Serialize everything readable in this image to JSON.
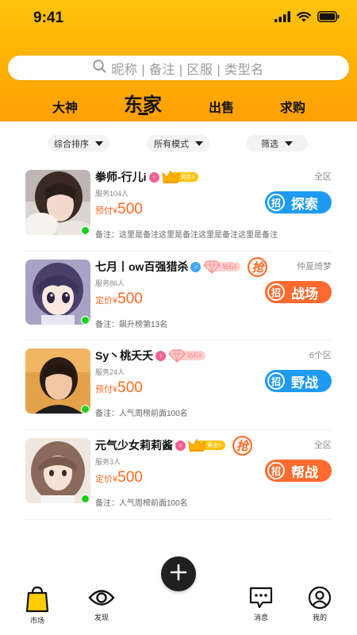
{
  "status_bar": {
    "time": "9:41"
  },
  "search": {
    "placeholder": "昵称 | 备注 | 区服 | 类型名"
  },
  "top_tabs": [
    {
      "label": "大神",
      "active": false
    },
    {
      "label": "东家",
      "active": true
    },
    {
      "label": "出售",
      "active": false
    },
    {
      "label": "求购",
      "active": false
    }
  ],
  "filters": [
    {
      "label": "综合排序"
    },
    {
      "label": "所有模式"
    },
    {
      "label": "筛选"
    }
  ],
  "listings": [
    {
      "name": "拳师-行儿i",
      "gender": "female",
      "gender_glyph": "♀",
      "rank_text": "黄金3",
      "rank_type": "gold",
      "rush": false,
      "region": "全区",
      "service_count": "服务104人",
      "price_label": "预付¥",
      "price_value": "500",
      "action_icon": "招",
      "action_label": "探索",
      "action_color": "#1e9bf0",
      "note": "备注：这里是备注这里是备注这里是备注这里是备注",
      "online": true
    },
    {
      "name": "七月丨ow百强猎杀",
      "gender": "male",
      "gender_glyph": "♂",
      "rank_text": "钻石1",
      "rank_type": "diamond",
      "rush": true,
      "rush_glyph": "抢",
      "region": "仲夏绮梦",
      "service_count": "服务86人",
      "price_label": "定价¥",
      "price_value": "500",
      "action_icon": "招",
      "action_label": "战场",
      "action_color": "#ff6a2e",
      "note": "备注：飙升榜第13名",
      "online": true
    },
    {
      "name": "Sy丶桃夭夭",
      "gender": "female",
      "gender_glyph": "♀",
      "rank_text": "钻石3",
      "rank_type": "diamond",
      "rush": false,
      "region": "6个区",
      "service_count": "服务24人",
      "price_label": "预付¥",
      "price_value": "500",
      "action_icon": "招",
      "action_label": "野战",
      "action_color": "#1e9bf0",
      "note": "备注：人气周榜前面100名",
      "online": true
    },
    {
      "name": "元气少女莉莉酱",
      "gender": "female",
      "gender_glyph": "♀",
      "rank_text": "黄金5",
      "rank_type": "gold",
      "rush": true,
      "rush_glyph": "抢",
      "region": "全区",
      "service_count": "服务3人",
      "price_label": "定价¥",
      "price_value": "500",
      "action_icon": "招",
      "action_label": "帮战",
      "action_color": "#ff6a2e",
      "note": "备注：人气周榜前面100名",
      "online": true
    }
  ],
  "bottom_nav": {
    "items": [
      {
        "label": "市场",
        "icon": "shopping-bag-icon",
        "active": true
      },
      {
        "label": "发现",
        "icon": "eye-icon",
        "active": false
      },
      {
        "label": "消息",
        "icon": "message-icon",
        "active": false
      },
      {
        "label": "我的",
        "icon": "profile-icon",
        "active": false
      }
    ],
    "fab_icon": "plus-icon"
  },
  "colors": {
    "header_top": "#ffc30a",
    "header_bottom": "#ff9f05",
    "accent_orange": "#ff6b1f",
    "button_blue": "#1e9bf0",
    "button_orange": "#ff6a2e",
    "online_green": "#1bd21b"
  }
}
